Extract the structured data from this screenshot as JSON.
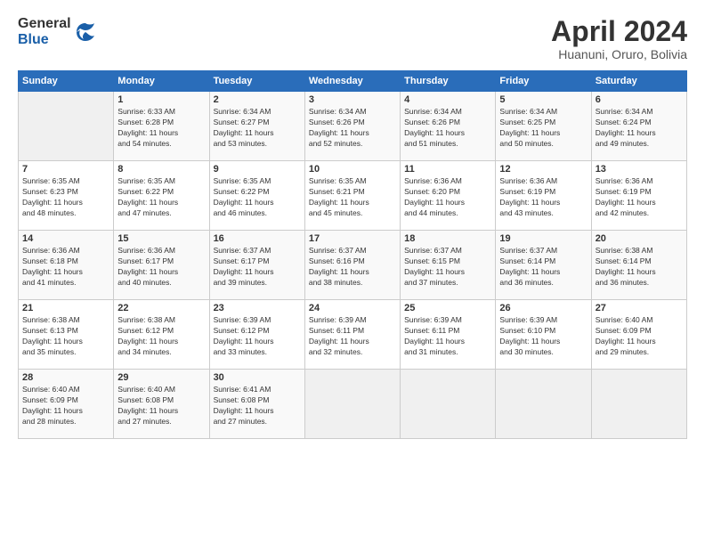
{
  "logo": {
    "general": "General",
    "blue": "Blue"
  },
  "header": {
    "title": "April 2024",
    "subtitle": "Huanuni, Oruro, Bolivia"
  },
  "weekdays": [
    "Sunday",
    "Monday",
    "Tuesday",
    "Wednesday",
    "Thursday",
    "Friday",
    "Saturday"
  ],
  "weeks": [
    [
      {
        "day": "",
        "info": ""
      },
      {
        "day": "1",
        "info": "Sunrise: 6:33 AM\nSunset: 6:28 PM\nDaylight: 11 hours\nand 54 minutes."
      },
      {
        "day": "2",
        "info": "Sunrise: 6:34 AM\nSunset: 6:27 PM\nDaylight: 11 hours\nand 53 minutes."
      },
      {
        "day": "3",
        "info": "Sunrise: 6:34 AM\nSunset: 6:26 PM\nDaylight: 11 hours\nand 52 minutes."
      },
      {
        "day": "4",
        "info": "Sunrise: 6:34 AM\nSunset: 6:26 PM\nDaylight: 11 hours\nand 51 minutes."
      },
      {
        "day": "5",
        "info": "Sunrise: 6:34 AM\nSunset: 6:25 PM\nDaylight: 11 hours\nand 50 minutes."
      },
      {
        "day": "6",
        "info": "Sunrise: 6:34 AM\nSunset: 6:24 PM\nDaylight: 11 hours\nand 49 minutes."
      }
    ],
    [
      {
        "day": "7",
        "info": "Sunrise: 6:35 AM\nSunset: 6:23 PM\nDaylight: 11 hours\nand 48 minutes."
      },
      {
        "day": "8",
        "info": "Sunrise: 6:35 AM\nSunset: 6:22 PM\nDaylight: 11 hours\nand 47 minutes."
      },
      {
        "day": "9",
        "info": "Sunrise: 6:35 AM\nSunset: 6:22 PM\nDaylight: 11 hours\nand 46 minutes."
      },
      {
        "day": "10",
        "info": "Sunrise: 6:35 AM\nSunset: 6:21 PM\nDaylight: 11 hours\nand 45 minutes."
      },
      {
        "day": "11",
        "info": "Sunrise: 6:36 AM\nSunset: 6:20 PM\nDaylight: 11 hours\nand 44 minutes."
      },
      {
        "day": "12",
        "info": "Sunrise: 6:36 AM\nSunset: 6:19 PM\nDaylight: 11 hours\nand 43 minutes."
      },
      {
        "day": "13",
        "info": "Sunrise: 6:36 AM\nSunset: 6:19 PM\nDaylight: 11 hours\nand 42 minutes."
      }
    ],
    [
      {
        "day": "14",
        "info": "Sunrise: 6:36 AM\nSunset: 6:18 PM\nDaylight: 11 hours\nand 41 minutes."
      },
      {
        "day": "15",
        "info": "Sunrise: 6:36 AM\nSunset: 6:17 PM\nDaylight: 11 hours\nand 40 minutes."
      },
      {
        "day": "16",
        "info": "Sunrise: 6:37 AM\nSunset: 6:17 PM\nDaylight: 11 hours\nand 39 minutes."
      },
      {
        "day": "17",
        "info": "Sunrise: 6:37 AM\nSunset: 6:16 PM\nDaylight: 11 hours\nand 38 minutes."
      },
      {
        "day": "18",
        "info": "Sunrise: 6:37 AM\nSunset: 6:15 PM\nDaylight: 11 hours\nand 37 minutes."
      },
      {
        "day": "19",
        "info": "Sunrise: 6:37 AM\nSunset: 6:14 PM\nDaylight: 11 hours\nand 36 minutes."
      },
      {
        "day": "20",
        "info": "Sunrise: 6:38 AM\nSunset: 6:14 PM\nDaylight: 11 hours\nand 36 minutes."
      }
    ],
    [
      {
        "day": "21",
        "info": "Sunrise: 6:38 AM\nSunset: 6:13 PM\nDaylight: 11 hours\nand 35 minutes."
      },
      {
        "day": "22",
        "info": "Sunrise: 6:38 AM\nSunset: 6:12 PM\nDaylight: 11 hours\nand 34 minutes."
      },
      {
        "day": "23",
        "info": "Sunrise: 6:39 AM\nSunset: 6:12 PM\nDaylight: 11 hours\nand 33 minutes."
      },
      {
        "day": "24",
        "info": "Sunrise: 6:39 AM\nSunset: 6:11 PM\nDaylight: 11 hours\nand 32 minutes."
      },
      {
        "day": "25",
        "info": "Sunrise: 6:39 AM\nSunset: 6:11 PM\nDaylight: 11 hours\nand 31 minutes."
      },
      {
        "day": "26",
        "info": "Sunrise: 6:39 AM\nSunset: 6:10 PM\nDaylight: 11 hours\nand 30 minutes."
      },
      {
        "day": "27",
        "info": "Sunrise: 6:40 AM\nSunset: 6:09 PM\nDaylight: 11 hours\nand 29 minutes."
      }
    ],
    [
      {
        "day": "28",
        "info": "Sunrise: 6:40 AM\nSunset: 6:09 PM\nDaylight: 11 hours\nand 28 minutes."
      },
      {
        "day": "29",
        "info": "Sunrise: 6:40 AM\nSunset: 6:08 PM\nDaylight: 11 hours\nand 27 minutes."
      },
      {
        "day": "30",
        "info": "Sunrise: 6:41 AM\nSunset: 6:08 PM\nDaylight: 11 hours\nand 27 minutes."
      },
      {
        "day": "",
        "info": ""
      },
      {
        "day": "",
        "info": ""
      },
      {
        "day": "",
        "info": ""
      },
      {
        "day": "",
        "info": ""
      }
    ]
  ]
}
